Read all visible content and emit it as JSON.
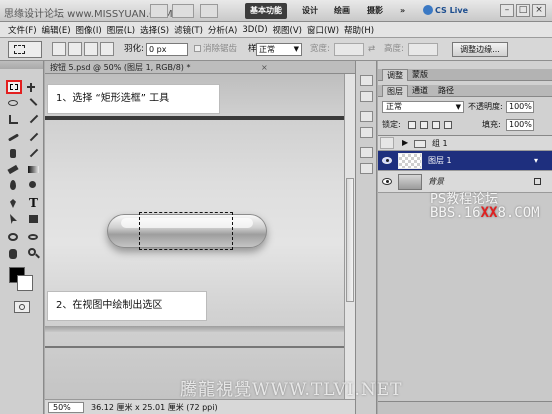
{
  "app": {
    "watermark_top": "思缘设计论坛 www.MISSYUAN.COM",
    "workspaces": [
      "基本功能",
      "设计",
      "绘画",
      "摄影",
      "»"
    ],
    "cslive": "CS Live",
    "window_buttons": {
      "minimize": "–",
      "maximize": "□",
      "close": "×"
    }
  },
  "menu": [
    "文件(F)",
    "编辑(E)",
    "图像(I)",
    "图层(L)",
    "选择(S)",
    "滤镜(T)",
    "分析(A)",
    "3D(D)",
    "视图(V)",
    "窗口(W)",
    "帮助(H)"
  ],
  "options": {
    "feather_label": "羽化:",
    "feather_value": "0 px",
    "antialias_label": "消除锯齿",
    "style_label": "样式:",
    "style_value": "正常",
    "width_label": "宽度:",
    "height_label": "高度:",
    "refine_edge": "调整边缘..."
  },
  "document": {
    "tab_label": "按钮 5.psd @ 50% (图层 1, RGB/8) *",
    "tab_close": "×",
    "callout_1": "1、选择 “矩形选框” 工具",
    "callout_2": "2、在视图中绘制出选区"
  },
  "status": {
    "zoom": "50%",
    "doc_info": "36.12 厘米 x 25.01 厘米 (72 ppi)"
  },
  "panels": {
    "tabs_top": [
      "调整",
      "蒙版"
    ],
    "tabs_layers": [
      "图层",
      "通道",
      "路径"
    ],
    "blend_mode": "正常",
    "opacity_label": "不透明度:",
    "opacity_value": "100%",
    "lock_label": "锁定:",
    "fill_label": "填充:",
    "fill_value": "100%",
    "layers": [
      {
        "name": "组 1",
        "type": "group"
      },
      {
        "name": "图层 1",
        "type": "layer",
        "selected": true
      },
      {
        "name": "背景",
        "type": "background"
      }
    ]
  },
  "watermarks": {
    "ps": "PS教程论坛",
    "bbs_prefix": "BBS.16",
    "bbs_mid": "XX",
    "bbs_suffix": "8.COM",
    "bottom": "騰龍視覺WWW.TLVI.NET"
  },
  "colors": {
    "selected_layer": "#1e2f7e",
    "highlight_tool_border": "#e32020",
    "active_workspace": "#3c3c3c"
  }
}
